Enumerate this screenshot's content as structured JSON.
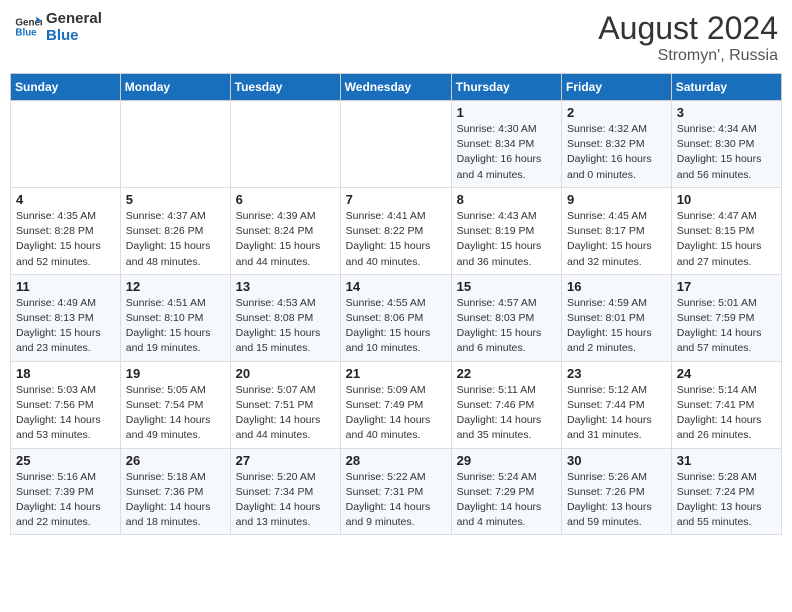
{
  "header": {
    "logo_general": "General",
    "logo_blue": "Blue",
    "month_year": "August 2024",
    "location": "Stromyn', Russia"
  },
  "weekdays": [
    "Sunday",
    "Monday",
    "Tuesday",
    "Wednesday",
    "Thursday",
    "Friday",
    "Saturday"
  ],
  "weeks": [
    [
      {
        "day": "",
        "detail": ""
      },
      {
        "day": "",
        "detail": ""
      },
      {
        "day": "",
        "detail": ""
      },
      {
        "day": "",
        "detail": ""
      },
      {
        "day": "1",
        "detail": "Sunrise: 4:30 AM\nSunset: 8:34 PM\nDaylight: 16 hours\nand 4 minutes."
      },
      {
        "day": "2",
        "detail": "Sunrise: 4:32 AM\nSunset: 8:32 PM\nDaylight: 16 hours\nand 0 minutes."
      },
      {
        "day": "3",
        "detail": "Sunrise: 4:34 AM\nSunset: 8:30 PM\nDaylight: 15 hours\nand 56 minutes."
      }
    ],
    [
      {
        "day": "4",
        "detail": "Sunrise: 4:35 AM\nSunset: 8:28 PM\nDaylight: 15 hours\nand 52 minutes."
      },
      {
        "day": "5",
        "detail": "Sunrise: 4:37 AM\nSunset: 8:26 PM\nDaylight: 15 hours\nand 48 minutes."
      },
      {
        "day": "6",
        "detail": "Sunrise: 4:39 AM\nSunset: 8:24 PM\nDaylight: 15 hours\nand 44 minutes."
      },
      {
        "day": "7",
        "detail": "Sunrise: 4:41 AM\nSunset: 8:22 PM\nDaylight: 15 hours\nand 40 minutes."
      },
      {
        "day": "8",
        "detail": "Sunrise: 4:43 AM\nSunset: 8:19 PM\nDaylight: 15 hours\nand 36 minutes."
      },
      {
        "day": "9",
        "detail": "Sunrise: 4:45 AM\nSunset: 8:17 PM\nDaylight: 15 hours\nand 32 minutes."
      },
      {
        "day": "10",
        "detail": "Sunrise: 4:47 AM\nSunset: 8:15 PM\nDaylight: 15 hours\nand 27 minutes."
      }
    ],
    [
      {
        "day": "11",
        "detail": "Sunrise: 4:49 AM\nSunset: 8:13 PM\nDaylight: 15 hours\nand 23 minutes."
      },
      {
        "day": "12",
        "detail": "Sunrise: 4:51 AM\nSunset: 8:10 PM\nDaylight: 15 hours\nand 19 minutes."
      },
      {
        "day": "13",
        "detail": "Sunrise: 4:53 AM\nSunset: 8:08 PM\nDaylight: 15 hours\nand 15 minutes."
      },
      {
        "day": "14",
        "detail": "Sunrise: 4:55 AM\nSunset: 8:06 PM\nDaylight: 15 hours\nand 10 minutes."
      },
      {
        "day": "15",
        "detail": "Sunrise: 4:57 AM\nSunset: 8:03 PM\nDaylight: 15 hours\nand 6 minutes."
      },
      {
        "day": "16",
        "detail": "Sunrise: 4:59 AM\nSunset: 8:01 PM\nDaylight: 15 hours\nand 2 minutes."
      },
      {
        "day": "17",
        "detail": "Sunrise: 5:01 AM\nSunset: 7:59 PM\nDaylight: 14 hours\nand 57 minutes."
      }
    ],
    [
      {
        "day": "18",
        "detail": "Sunrise: 5:03 AM\nSunset: 7:56 PM\nDaylight: 14 hours\nand 53 minutes."
      },
      {
        "day": "19",
        "detail": "Sunrise: 5:05 AM\nSunset: 7:54 PM\nDaylight: 14 hours\nand 49 minutes."
      },
      {
        "day": "20",
        "detail": "Sunrise: 5:07 AM\nSunset: 7:51 PM\nDaylight: 14 hours\nand 44 minutes."
      },
      {
        "day": "21",
        "detail": "Sunrise: 5:09 AM\nSunset: 7:49 PM\nDaylight: 14 hours\nand 40 minutes."
      },
      {
        "day": "22",
        "detail": "Sunrise: 5:11 AM\nSunset: 7:46 PM\nDaylight: 14 hours\nand 35 minutes."
      },
      {
        "day": "23",
        "detail": "Sunrise: 5:12 AM\nSunset: 7:44 PM\nDaylight: 14 hours\nand 31 minutes."
      },
      {
        "day": "24",
        "detail": "Sunrise: 5:14 AM\nSunset: 7:41 PM\nDaylight: 14 hours\nand 26 minutes."
      }
    ],
    [
      {
        "day": "25",
        "detail": "Sunrise: 5:16 AM\nSunset: 7:39 PM\nDaylight: 14 hours\nand 22 minutes."
      },
      {
        "day": "26",
        "detail": "Sunrise: 5:18 AM\nSunset: 7:36 PM\nDaylight: 14 hours\nand 18 minutes."
      },
      {
        "day": "27",
        "detail": "Sunrise: 5:20 AM\nSunset: 7:34 PM\nDaylight: 14 hours\nand 13 minutes."
      },
      {
        "day": "28",
        "detail": "Sunrise: 5:22 AM\nSunset: 7:31 PM\nDaylight: 14 hours\nand 9 minutes."
      },
      {
        "day": "29",
        "detail": "Sunrise: 5:24 AM\nSunset: 7:29 PM\nDaylight: 14 hours\nand 4 minutes."
      },
      {
        "day": "30",
        "detail": "Sunrise: 5:26 AM\nSunset: 7:26 PM\nDaylight: 13 hours\nand 59 minutes."
      },
      {
        "day": "31",
        "detail": "Sunrise: 5:28 AM\nSunset: 7:24 PM\nDaylight: 13 hours\nand 55 minutes."
      }
    ]
  ]
}
